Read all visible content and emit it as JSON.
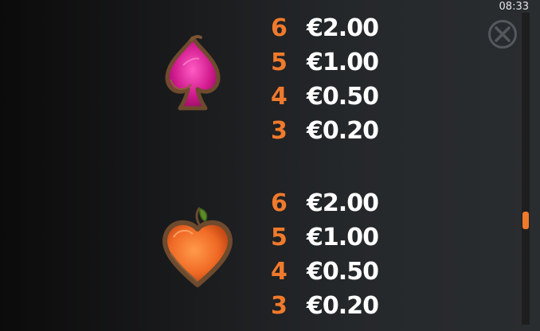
{
  "status_bar": {
    "time": "08:33"
  },
  "close_button": {
    "icon": "close-icon"
  },
  "symbols": [
    {
      "icon": "spade-icon",
      "colors": {
        "fill": "#d11b8e",
        "frame": "#6e4a2e"
      },
      "payouts": [
        {
          "count": "6",
          "amount": "€2.00"
        },
        {
          "count": "5",
          "amount": "€1.00"
        },
        {
          "count": "4",
          "amount": "€0.50"
        },
        {
          "count": "3",
          "amount": "€0.20"
        }
      ]
    },
    {
      "icon": "heart-icon",
      "colors": {
        "fill": "#f06a26",
        "frame": "#6e4a2e",
        "leaf": "#5c8a2a"
      },
      "payouts": [
        {
          "count": "6",
          "amount": "€2.00"
        },
        {
          "count": "5",
          "amount": "€1.00"
        },
        {
          "count": "4",
          "amount": "€0.50"
        },
        {
          "count": "3",
          "amount": "€0.20"
        }
      ]
    }
  ],
  "colors": {
    "count": "#f07a2c",
    "amount": "#ffffff",
    "scroll_thumb": "#f07a2c"
  },
  "scroll": {
    "position": 0.68
  }
}
